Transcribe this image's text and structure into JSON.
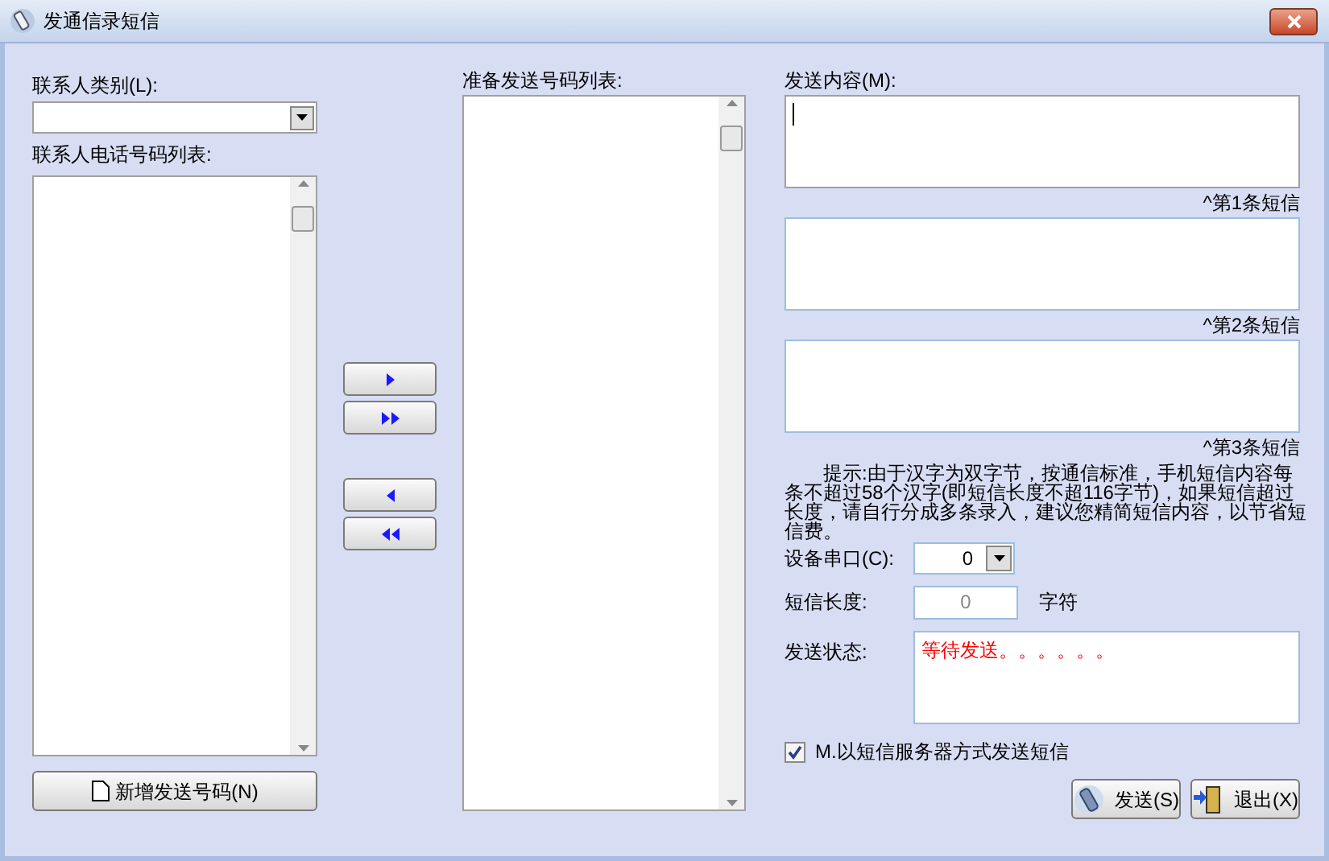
{
  "window": {
    "title": "发通信录短信"
  },
  "contacts": {
    "category_label": "联系人类别(L):",
    "list_label": "联系人电话号码列表:",
    "add_button": "新增发送号码(N)"
  },
  "send_list": {
    "label": "准备发送号码列表:"
  },
  "message": {
    "label": "发送内容(M):",
    "parts": [
      {
        "caption": "^第1条短信",
        "focused": true
      },
      {
        "caption": "^第2条短信",
        "focused": false
      },
      {
        "caption": "^第3条短信",
        "focused": false
      }
    ],
    "hint": "提示:由于汉字为双字节，按通信标准，手机短信内容每条不超过58个汉字(即短信长度不超116字节)，如果短信超过长度，请自行分成多条录入，建议您精简短信内容，以节省短信费。"
  },
  "port": {
    "label": "设备串口(C):",
    "value": "0"
  },
  "length": {
    "label": "短信长度:",
    "value": "0",
    "unit": "字符"
  },
  "status": {
    "label": "发送状态:",
    "value": "等待发送。。。。。。"
  },
  "server_mode": {
    "label": "M.以短信服务器方式发送短信",
    "checked": true
  },
  "buttons": [
    {
      "kind": "send",
      "label": "发送(S)"
    },
    {
      "kind": "exit",
      "label": "退出(X)"
    }
  ]
}
